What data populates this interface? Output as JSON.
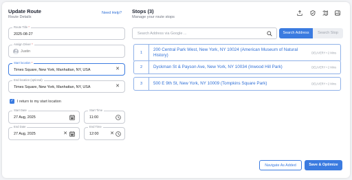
{
  "header": {
    "title": "Update Route",
    "subtitle": "Route Details",
    "help_link": "Need Help?"
  },
  "form": {
    "route_title": {
      "label": "Route Title",
      "value": "2025-08-27"
    },
    "assign_driver": {
      "label": "Assign Driver",
      "value": "Justin"
    },
    "start_location": {
      "label": "Start location",
      "value": "Times Square, New York, Manhattan, NY, USA"
    },
    "end_location": {
      "label": "End location (optional)",
      "value": "Times Square, New York, Manhattan, NY, USA"
    },
    "return_to_start": {
      "label": "I return to my start location",
      "checked": true
    },
    "start_date": {
      "label": "Start Date",
      "value": "27 Aug, 2025"
    },
    "start_time": {
      "label": "Start Time",
      "value": "11:00"
    },
    "end_date": {
      "label": "End Date",
      "value": "27 Aug, 2025"
    },
    "end_time": {
      "label": "End Time",
      "value": "12:00"
    },
    "required_mark": "*"
  },
  "stops": {
    "title": "Stops (3)",
    "subtitle": "Manage your route stops",
    "search_placeholder": "Search Address via Google ...",
    "toggle_address": "Search Address",
    "toggle_stop": "Search Stop",
    "items": [
      {
        "num": "1",
        "address": "200 Central Park West, New York, NY 10024 (American Museum of Natural History)",
        "meta": "DELIVERY • 2 Mins"
      },
      {
        "num": "2",
        "address": "Dyckman St & Payson Ave, New York, NY 10034 (Inwood Hill Park)",
        "meta": "DELIVERY • 2 Mins"
      },
      {
        "num": "3",
        "address": "500 E 9th St, New York, NY 10009 (Tompkins Square Park)",
        "meta": "DELIVERY • 2 Mins"
      }
    ]
  },
  "actions": {
    "navigate_label": "Navigate As Added",
    "save_label": "Save & Optimize"
  },
  "colors": {
    "accent": "#3b7be0",
    "link": "#2f6fd6",
    "border": "#c9ccd3"
  }
}
